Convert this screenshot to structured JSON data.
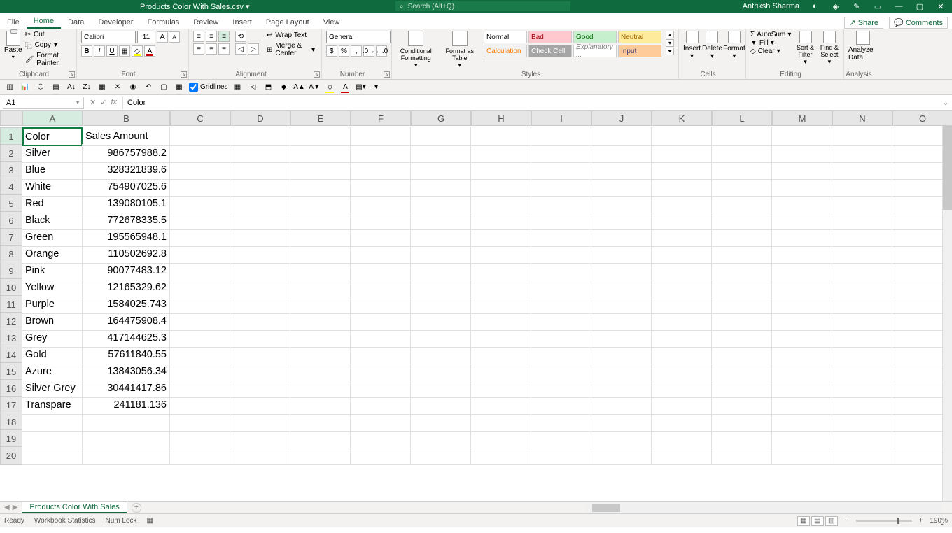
{
  "titlebar": {
    "filename": "Products Color With Sales.csv ▾",
    "search_placeholder": "Search (Alt+Q)",
    "username": "Antriksh Sharma"
  },
  "tabs": {
    "items": [
      "File",
      "Home",
      "Data",
      "Developer",
      "Formulas",
      "Review",
      "Insert",
      "Page Layout",
      "View"
    ],
    "active": "Home",
    "share": "Share",
    "comments": "Comments"
  },
  "ribbon": {
    "clipboard": {
      "label": "Clipboard",
      "paste": "Paste",
      "cut": "Cut",
      "copy": "Copy",
      "fmt_painter": "Format Painter"
    },
    "font": {
      "label": "Font",
      "name": "Calibri",
      "size": "11",
      "grow": "A",
      "shrink": "A"
    },
    "alignment": {
      "label": "Alignment",
      "wrap": "Wrap Text",
      "merge": "Merge & Center"
    },
    "number": {
      "label": "Number",
      "format": "General",
      "currency": "$",
      "pct": "%",
      "comma": ","
    },
    "styles": {
      "label": "Styles",
      "cond": "Conditional Formatting",
      "as_table": "Format as Table",
      "gallery": [
        "Normal",
        "Bad",
        "Good",
        "Neutral",
        "Calculation",
        "Check Cell",
        "Explanatory ...",
        "Input"
      ]
    },
    "cells": {
      "label": "Cells",
      "insert": "Insert",
      "delete": "Delete",
      "format": "Format"
    },
    "editing": {
      "label": "Editing",
      "autosum": "AutoSum",
      "fill": "Fill",
      "clear": "Clear",
      "sort": "Sort & Filter",
      "find": "Find & Select"
    },
    "analysis": {
      "label": "Analysis",
      "analyze": "Analyze Data"
    }
  },
  "qat": {
    "gridlines": "Gridlines"
  },
  "namebox": {
    "ref": "A1"
  },
  "formula": {
    "value": "Color"
  },
  "columns": [
    "A",
    "B",
    "C",
    "D",
    "E",
    "F",
    "G",
    "H",
    "I",
    "J",
    "K",
    "L",
    "M",
    "N",
    "O"
  ],
  "rows": [
    {
      "n": 1,
      "a": "Color",
      "b": "Sales Amount"
    },
    {
      "n": 2,
      "a": "Silver",
      "b": "986757988.2"
    },
    {
      "n": 3,
      "a": "Blue",
      "b": "328321839.6"
    },
    {
      "n": 4,
      "a": "White",
      "b": "754907025.6"
    },
    {
      "n": 5,
      "a": "Red",
      "b": "139080105.1"
    },
    {
      "n": 6,
      "a": "Black",
      "b": "772678335.5"
    },
    {
      "n": 7,
      "a": "Green",
      "b": "195565948.1"
    },
    {
      "n": 8,
      "a": "Orange",
      "b": "110502692.8"
    },
    {
      "n": 9,
      "a": "Pink",
      "b": "90077483.12"
    },
    {
      "n": 10,
      "a": "Yellow",
      "b": "12165329.62"
    },
    {
      "n": 11,
      "a": "Purple",
      "b": "1584025.743"
    },
    {
      "n": 12,
      "a": "Brown",
      "b": "164475908.4"
    },
    {
      "n": 13,
      "a": "Grey",
      "b": "417144625.3"
    },
    {
      "n": 14,
      "a": "Gold",
      "b": "57611840.55"
    },
    {
      "n": 15,
      "a": "Azure",
      "b": "13843056.34"
    },
    {
      "n": 16,
      "a": "Silver Grey",
      "b": "30441417.86"
    },
    {
      "n": 17,
      "a": "Transpare",
      "b": "241181.136"
    },
    {
      "n": 18,
      "a": "",
      "b": ""
    },
    {
      "n": 19,
      "a": "",
      "b": ""
    },
    {
      "n": 20,
      "a": "",
      "b": ""
    }
  ],
  "sheettabs": {
    "active": "Products Color With Sales"
  },
  "statusbar": {
    "ready": "Ready",
    "wbstats": "Workbook Statistics",
    "numlock": "Num Lock",
    "zoom": "190%"
  }
}
